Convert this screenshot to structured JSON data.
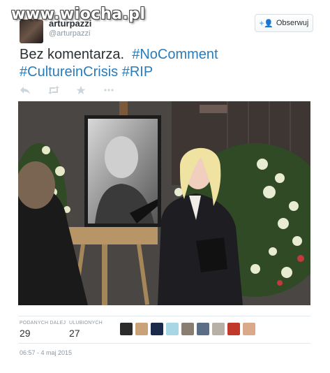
{
  "watermark": "www.wiocha.pl",
  "user": {
    "name": "arturpazzi",
    "handle": "@arturpazzi"
  },
  "follow_button": {
    "label": "Obserwuj",
    "icon": "add-user-icon"
  },
  "tweet": {
    "text_plain": "Bez komentarza.",
    "hashtags": [
      "#NoComment",
      "#CultureinCrisis",
      "#RIP"
    ]
  },
  "actions": [
    {
      "name": "reply",
      "icon": "reply-icon"
    },
    {
      "name": "retweet",
      "icon": "retweet-icon"
    },
    {
      "name": "favorite",
      "icon": "star-icon"
    },
    {
      "name": "more",
      "icon": "more-icon"
    }
  ],
  "stats": {
    "retweets_label": "PODANYCH DALEJ",
    "retweets_value": "29",
    "favorites_label": "ULUBIONYCH",
    "favorites_value": "27"
  },
  "timestamp": "06:57 - 4 maj 2015",
  "colors": {
    "link": "#2b7bb9",
    "accent": "#55acee",
    "muted": "#8899a6"
  }
}
